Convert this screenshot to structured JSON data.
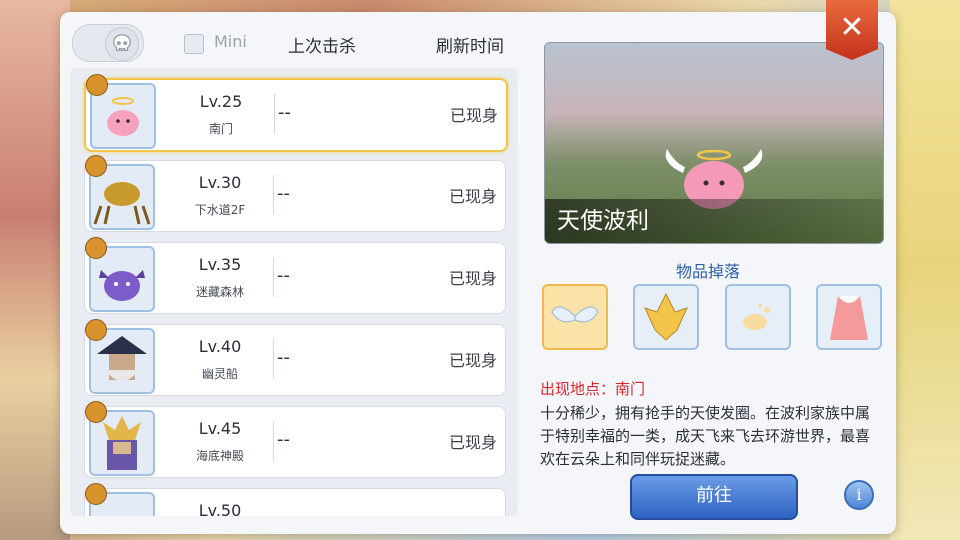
{
  "header": {
    "mini_label": "Mini",
    "last_kill_label": "上次击杀",
    "refresh_label": "刷新时间"
  },
  "list": [
    {
      "level": "Lv.25",
      "location": "南门",
      "last_kill": "--",
      "status": "已现身",
      "selected": true
    },
    {
      "level": "Lv.30",
      "location": "下水道2F",
      "last_kill": "--",
      "status": "已现身"
    },
    {
      "level": "Lv.35",
      "location": "迷藏森林",
      "last_kill": "--",
      "status": "已现身"
    },
    {
      "level": "Lv.40",
      "location": "幽灵船",
      "last_kill": "--",
      "status": "已现身"
    },
    {
      "level": "Lv.45",
      "location": "海底神殿",
      "last_kill": "--",
      "status": "已现身"
    },
    {
      "level": "Lv.50",
      "location": "",
      "last_kill": "",
      "status": ""
    }
  ],
  "detail": {
    "monster_name": "天使波利",
    "drops_title": "物品掉落",
    "drops": [
      "angel-wings-icon",
      "golden-crystal-icon",
      "egg-item-icon",
      "pink-costume-icon"
    ],
    "place_text": "出现地点：南门",
    "description": "十分稀少，拥有抢手的天使发圈。在波利家族中属于特别幸福的一类，成天飞来飞去环游世界，最喜欢在云朵上和同伴玩捉迷藏。",
    "go_label": "前往",
    "info_label": "i",
    "close_label": "✕"
  },
  "colors": {
    "accent_blue": "#2e62c2",
    "selected_gold": "#f2c44a",
    "place_red": "#d8262c"
  }
}
